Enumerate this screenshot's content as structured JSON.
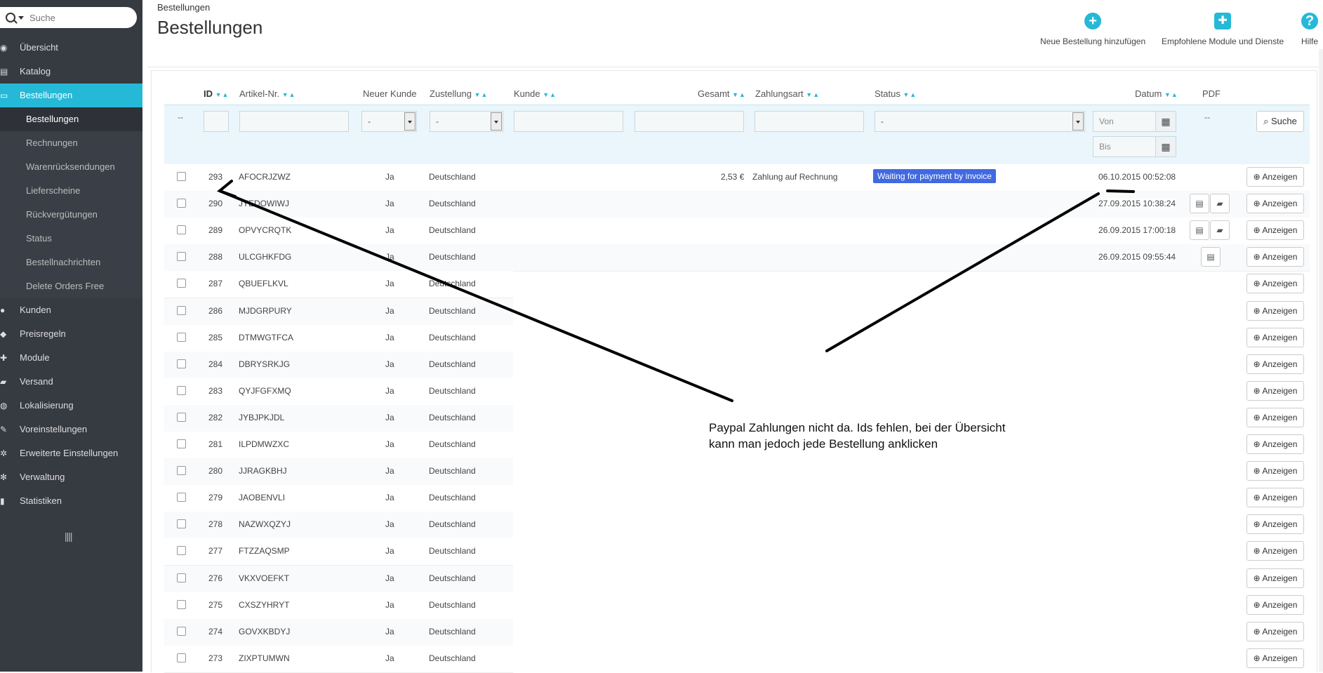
{
  "sidebar": {
    "search_placeholder": "Suche",
    "items": [
      {
        "icon": "dashboard-icon",
        "label": "Übersicht"
      },
      {
        "icon": "book-icon",
        "label": "Katalog"
      },
      {
        "icon": "credit-card-icon",
        "label": "Bestellungen",
        "active": true
      },
      {
        "icon": "users-icon",
        "label": "Kunden"
      },
      {
        "icon": "tag-icon",
        "label": "Preisregeln"
      },
      {
        "icon": "puzzle-icon",
        "label": "Module"
      },
      {
        "icon": "truck-icon",
        "label": "Versand"
      },
      {
        "icon": "globe-icon",
        "label": "Lokalisierung"
      },
      {
        "icon": "wrench-icon",
        "label": "Voreinstellungen"
      },
      {
        "icon": "cogs-icon",
        "label": "Erweiterte Einstellungen"
      },
      {
        "icon": "gear-icon",
        "label": "Verwaltung"
      },
      {
        "icon": "bar-chart-icon",
        "label": "Statistiken"
      }
    ],
    "subitems": [
      "Bestellungen",
      "Rechnungen",
      "Warenrücksendungen",
      "Lieferscheine",
      "Rückvergütungen",
      "Status",
      "Bestellnachrichten",
      "Delete Orders Free"
    ],
    "collapse_glyph": "||||"
  },
  "header": {
    "breadcrumb": "Bestellungen",
    "title": "Bestellungen",
    "toolbar": [
      {
        "icon": "plus-circle-icon",
        "label": "Neue Bestellung hinzufügen"
      },
      {
        "icon": "puzzle-icon",
        "label": "Empfohlene Module und Dienste"
      },
      {
        "icon": "help-icon",
        "label": "Hilfe"
      }
    ]
  },
  "table": {
    "columns": [
      "ID",
      "Artikel-Nr.",
      "Neuer Kunde",
      "Zustellung",
      "Kunde",
      "Gesamt",
      "Zahlungsart",
      "Status",
      "Datum",
      "PDF"
    ],
    "filters": {
      "first_col": "--",
      "new_customer": "-",
      "delivery": "-",
      "status": "-",
      "date_from": "Von",
      "date_to": "Bis",
      "pdf": "--",
      "search_label": "Suche"
    },
    "view_label": "Anzeigen",
    "rows": [
      {
        "id": "293",
        "ref": "AFOCRJZWZ",
        "new": "Ja",
        "country": "Deutschland",
        "total": "2,53 €",
        "payment": "Zahlung auf Rechnung",
        "status": "Waiting for payment by invoice",
        "date": "06.10.2015 00:52:08"
      },
      {
        "id": "290",
        "ref": "JYEDOWIWJ",
        "new": "Ja",
        "country": "Deutschland",
        "date": "27.09.2015 10:38:24"
      },
      {
        "id": "289",
        "ref": "OPVYCRQTK",
        "new": "Ja",
        "country": "Deutschland",
        "date": "26.09.2015 17:00:18"
      },
      {
        "id": "288",
        "ref": "ULCGHKFDG",
        "new": "Ja",
        "country": "Deutschland",
        "date": "26.09.2015 09:55:44"
      },
      {
        "id": "287",
        "ref": "QBUEFLKVL",
        "new": "Ja",
        "country": "Deutschland"
      },
      {
        "id": "286",
        "ref": "MJDGRPURY",
        "new": "Ja",
        "country": "Deutschland"
      },
      {
        "id": "285",
        "ref": "DTMWGTFCA",
        "new": "Ja",
        "country": "Deutschland"
      },
      {
        "id": "284",
        "ref": "DBRYSRKJG",
        "new": "Ja",
        "country": "Deutschland"
      },
      {
        "id": "283",
        "ref": "QYJFGFXMQ",
        "new": "Ja",
        "country": "Deutschland"
      },
      {
        "id": "282",
        "ref": "JYBJPKJDL",
        "new": "Ja",
        "country": "Deutschland"
      },
      {
        "id": "281",
        "ref": "ILPDMWZXC",
        "new": "Ja",
        "country": "Deutschland"
      },
      {
        "id": "280",
        "ref": "JJRAGKBHJ",
        "new": "Ja",
        "country": "Deutschland"
      },
      {
        "id": "279",
        "ref": "JAOBENVLI",
        "new": "Ja",
        "country": "Deutschland"
      },
      {
        "id": "278",
        "ref": "NAZWXQZYJ",
        "new": "Ja",
        "country": "Deutschland"
      },
      {
        "id": "277",
        "ref": "FTZZAQSMP",
        "new": "Ja",
        "country": "Deutschland"
      },
      {
        "id": "276",
        "ref": "VKXVOEFKT",
        "new": "Ja",
        "country": "Deutschland"
      },
      {
        "id": "275",
        "ref": "CXSZYHRYT",
        "new": "Ja",
        "country": "Deutschland"
      },
      {
        "id": "274",
        "ref": "GOVXKBDYJ",
        "new": "Ja",
        "country": "Deutschland"
      },
      {
        "id": "273",
        "ref": "ZIXPTUMWN",
        "new": "Ja",
        "country": "Deutschland"
      }
    ]
  },
  "annotation": {
    "line1": "Paypal Zahlungen nicht da. Ids fehlen, bei der Übersicht",
    "line2": "kann man jedoch jede Bestellung anklicken"
  },
  "colors": {
    "accent": "#25b9d7",
    "sidebar": "#363a41",
    "badge": "#4169e1"
  }
}
